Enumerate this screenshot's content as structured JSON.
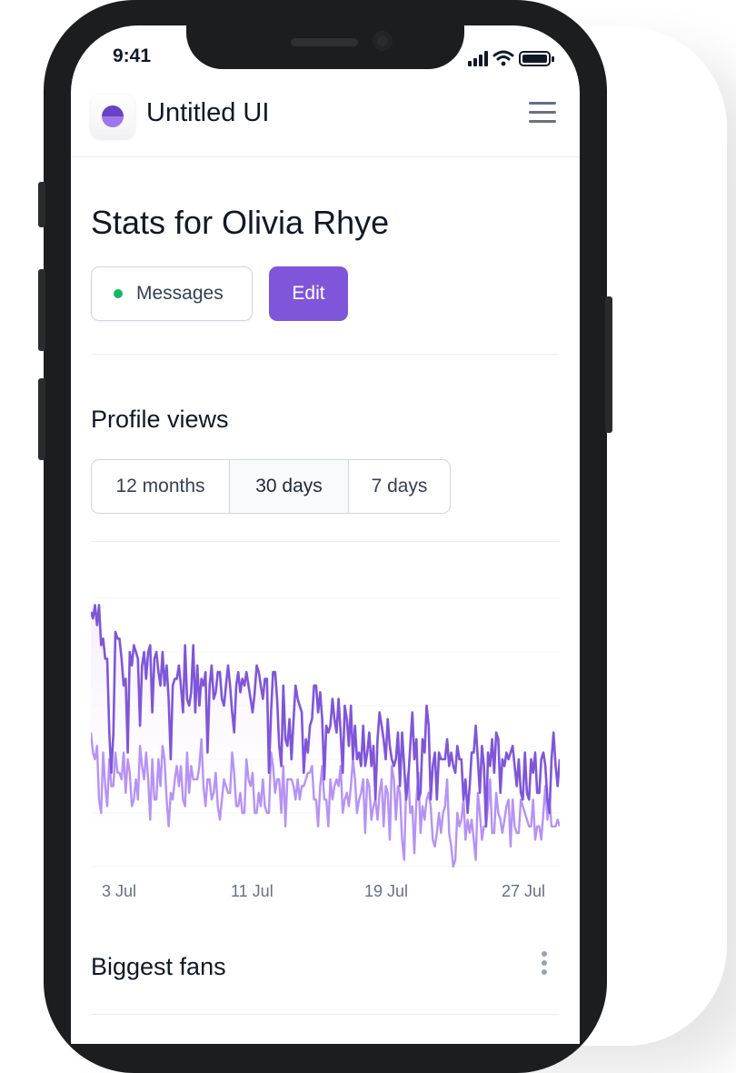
{
  "status_bar": {
    "time": "9:41"
  },
  "header": {
    "brand": "Untitled UI"
  },
  "page": {
    "title": "Stats for Olivia Rhye"
  },
  "actions": {
    "messages_label": "Messages",
    "edit_label": "Edit"
  },
  "profile_views": {
    "title": "Profile views",
    "tabs": [
      {
        "label": "12 months",
        "active": false
      },
      {
        "label": "30 days",
        "active": true
      },
      {
        "label": "7 days",
        "active": false
      }
    ]
  },
  "fans": {
    "title": "Biggest fans"
  },
  "colors": {
    "accent": "#7f56d9",
    "series_primary": "#7f56d9",
    "series_secondary": "#b692f6",
    "online": "#12b76a",
    "text": "#101828"
  },
  "chart_data": {
    "type": "line",
    "x_labels": [
      "3 Jul",
      "11 Jul",
      "19 Jul",
      "27 Jul"
    ],
    "grid": true,
    "series": [
      {
        "values": [
          38,
          37,
          39,
          36,
          39,
          33,
          34,
          31,
          31,
          20,
          14,
          20,
          35,
          34,
          34,
          31,
          27,
          28,
          17,
          32,
          30,
          33,
          32,
          31,
          21,
          30,
          32,
          28,
          32,
          33,
          23,
          31,
          32,
          29,
          27,
          32,
          27,
          30,
          25,
          16,
          27,
          28,
          28,
          30,
          27,
          23,
          33,
          25,
          24,
          26,
          33,
          23,
          30,
          24,
          28,
          27,
          29,
          17,
          27,
          30,
          25,
          26,
          29,
          29,
          25,
          24,
          27,
          30,
          27,
          23,
          20,
          27,
          29,
          26,
          28,
          27,
          29,
          27,
          25,
          23,
          26,
          30,
          29,
          27,
          25,
          28,
          28,
          14,
          23,
          29,
          29,
          25,
          18,
          15,
          27,
          19,
          18,
          22,
          16,
          22,
          27,
          25,
          24,
          23,
          14,
          19,
          17,
          21,
          22,
          27,
          27,
          23,
          26,
          22,
          13,
          21,
          20,
          21,
          25,
          22,
          20,
          25,
          20,
          14,
          24,
          22,
          18,
          24,
          16,
          21,
          16,
          17,
          15,
          21,
          15,
          17,
          20,
          15,
          18,
          10,
          19,
          23,
          21,
          19,
          16,
          22,
          18,
          16,
          15,
          16,
          20,
          12,
          20,
          15,
          10,
          13,
          18,
          23,
          16,
          19,
          10,
          11,
          19,
          17,
          24,
          21,
          10,
          15,
          17,
          10,
          17,
          16,
          16,
          16,
          19,
          15,
          17,
          15,
          14,
          18,
          16,
          16,
          10,
          13,
          8,
          12,
          17,
          17,
          21,
          16,
          11,
          18,
          15,
          6,
          17,
          15,
          19,
          14,
          20,
          19,
          11,
          16,
          15,
          17,
          16,
          17,
          18,
          15,
          12,
          16,
          11,
          10,
          17,
          11,
          10,
          16,
          14,
          17,
          11,
          11,
          16,
          17,
          15,
          10,
          8,
          16,
          20,
          15,
          12,
          16
        ]
      },
      {
        "values": [
          20,
          17,
          16,
          18,
          10,
          8,
          17,
          12,
          9,
          16,
          12,
          12,
          17,
          14,
          14,
          13,
          17,
          11,
          16,
          14,
          9,
          10,
          13,
          10,
          18,
          15,
          13,
          17,
          13,
          7,
          16,
          10,
          10,
          16,
          12,
          18,
          16,
          10,
          6,
          11,
          10,
          13,
          15,
          12,
          15,
          10,
          9,
          17,
          11,
          15,
          13,
          13,
          13,
          15,
          19,
          12,
          9,
          13,
          13,
          10,
          11,
          14,
          9,
          7,
          10,
          13,
          12,
          11,
          11,
          17,
          14,
          9,
          9,
          11,
          8,
          8,
          16,
          13,
          12,
          14,
          8,
          8,
          11,
          9,
          13,
          9,
          8,
          8,
          17,
          15,
          11,
          13,
          13,
          8,
          15,
          6,
          13,
          13,
          13,
          12,
          10,
          13,
          10,
          12,
          12,
          13,
          14,
          14,
          15,
          10,
          10,
          6,
          12,
          15,
          10,
          10,
          6,
          13,
          10,
          12,
          13,
          12,
          15,
          8,
          10,
          11,
          9,
          12,
          16,
          13,
          8,
          10,
          11,
          13,
          5,
          13,
          12,
          7,
          9,
          10,
          7,
          11,
          13,
          6,
          12,
          11,
          4,
          15,
          13,
          7,
          12,
          11,
          4,
          1,
          12,
          14,
          8,
          9,
          2,
          10,
          14,
          5,
          9,
          7,
          10,
          11,
          9,
          4,
          3,
          5,
          8,
          5,
          8,
          9,
          13,
          5,
          3,
          0,
          1,
          8,
          6,
          7,
          10,
          4,
          7,
          5,
          7,
          4,
          1,
          11,
          8,
          4,
          6,
          6,
          9,
          13,
          5,
          5,
          11,
          8,
          7,
          5,
          7,
          9,
          10,
          3,
          10,
          6,
          5,
          5,
          10,
          9,
          8,
          7,
          6,
          6,
          10,
          4,
          6,
          6,
          4,
          8,
          12,
          7,
          10,
          6,
          6,
          6,
          7,
          6
        ]
      }
    ]
  }
}
